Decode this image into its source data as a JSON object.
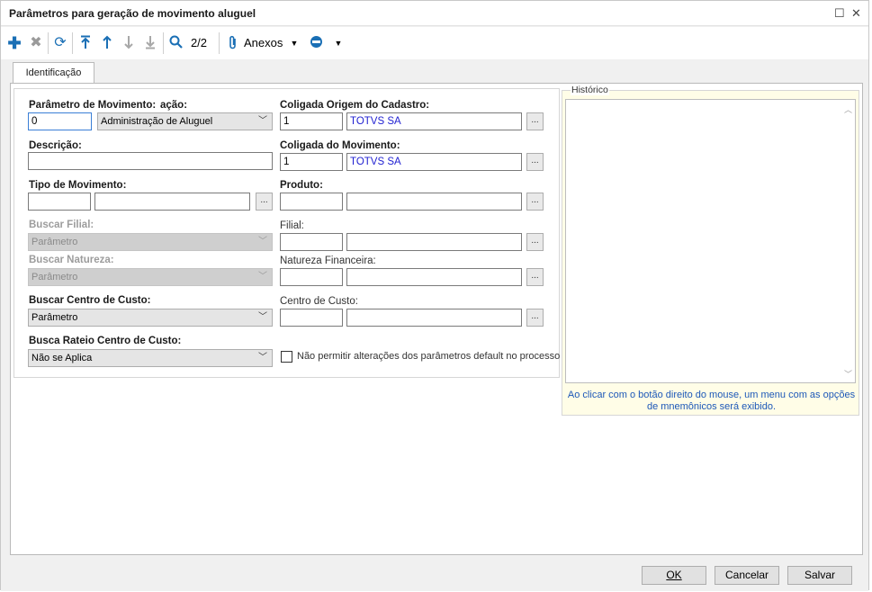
{
  "window": {
    "title": "Parâmetros para geração de movimento aluguel",
    "maximize_glyph": "☐",
    "close_glyph": "✕"
  },
  "toolbar": {
    "add_icon": "plus-icon",
    "delete_icon": "delete-icon",
    "refresh_icon": "refresh-icon",
    "first_icon": "first-record-icon",
    "prev_icon": "previous-record-icon",
    "next_icon": "next-record-icon",
    "last_icon": "last-record-icon",
    "search_icon": "search-icon",
    "record_counter": "2/2",
    "attachments_label": "Anexos",
    "accent_color": "#1a6fb5"
  },
  "tabs": [
    {
      "label": "Identificação"
    }
  ],
  "form": {
    "param_label": "Parâmetro de Movimento:",
    "param_overlap": "ação:",
    "param_code": "0",
    "param_select": "Administração de Aluguel",
    "descricao_label": "Descrição:",
    "descricao_value": "",
    "tipo_label": "Tipo de Movimento:",
    "tipo_code": "",
    "tipo_name": "",
    "buscar_filial_label": "Buscar Filial:",
    "buscar_filial_value": "Parâmetro",
    "buscar_natureza_label": "Buscar Natureza:",
    "buscar_natureza_value": "Parâmetro",
    "buscar_cc_label": "Buscar Centro de Custo:",
    "buscar_cc_value": "Parâmetro",
    "busca_rateio_label": "Busca Rateio Centro de Custo:",
    "busca_rateio_value": "Não se Aplica",
    "coligada_origem_label": "Coligada Origem do Cadastro:",
    "coligada_origem_code": "1",
    "coligada_origem_name": "TOTVS SA",
    "coligada_mov_label": "Coligada do Movimento:",
    "coligada_mov_code": "1",
    "coligada_mov_name": "TOTVS SA",
    "produto_label": "Produto:",
    "filial_label": "Filial:",
    "natureza_label": "Natureza Financeira:",
    "centro_custo_label": "Centro de Custo:",
    "checkbox_label": "Não permitir alterações dos parâmetros default no processo",
    "lookup_label": "..."
  },
  "historico": {
    "legend": "Histórico",
    "hint": "Ao clicar com o botão direito do mouse, um menu com as opções de mnemônicos será exibido."
  },
  "footer": {
    "ok_label": "OK",
    "cancel_label": "Cancelar",
    "save_label": "Salvar"
  }
}
